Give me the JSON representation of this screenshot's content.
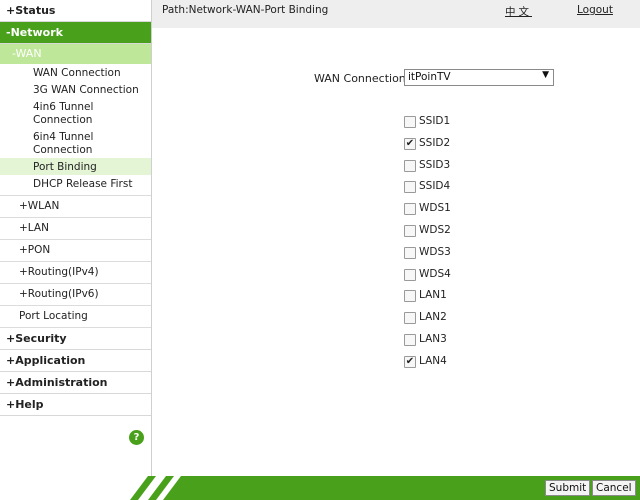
{
  "sidebar": {
    "status": "+Status",
    "network": "-Network",
    "wan": "-WAN",
    "wan_items": [
      {
        "label": "WAN Connection"
      },
      {
        "label": "3G WAN Connection"
      },
      {
        "label": "4in6 Tunnel Connection"
      },
      {
        "label": "6in4 Tunnel Connection"
      },
      {
        "label": "Port Binding",
        "active": true
      },
      {
        "label": "DHCP Release First"
      }
    ],
    "network_items": [
      "+WLAN",
      "+LAN",
      "+PON",
      "+Routing(IPv4)",
      "+Routing(IPv6)",
      "Port Locating"
    ],
    "bottom_items": [
      "+Security",
      "+Application",
      "+Administration",
      "+Help"
    ],
    "help_icon": "?"
  },
  "header": {
    "path": "Path:Network-WAN-Port Binding",
    "language": "中文",
    "logout": "Logout"
  },
  "form": {
    "wan_connection_label": "WAN Connection",
    "wan_connection_value": "itPoinTV",
    "ports": [
      {
        "label": "SSID1",
        "checked": false
      },
      {
        "label": "SSID2",
        "checked": true
      },
      {
        "label": "SSID3",
        "checked": false
      },
      {
        "label": "SSID4",
        "checked": false
      },
      {
        "label": "WDS1",
        "checked": false
      },
      {
        "label": "WDS2",
        "checked": false
      },
      {
        "label": "WDS3",
        "checked": false
      },
      {
        "label": "WDS4",
        "checked": false
      },
      {
        "label": "LAN1",
        "checked": false
      },
      {
        "label": "LAN2",
        "checked": false
      },
      {
        "label": "LAN3",
        "checked": false
      },
      {
        "label": "LAN4",
        "checked": true
      }
    ]
  },
  "footer": {
    "submit": "Submit",
    "cancel": "Cancel"
  },
  "colors": {
    "accent_green": "#49a11b",
    "light_green": "#bfe79a",
    "active_sub_bg": "#e4f5d6"
  }
}
